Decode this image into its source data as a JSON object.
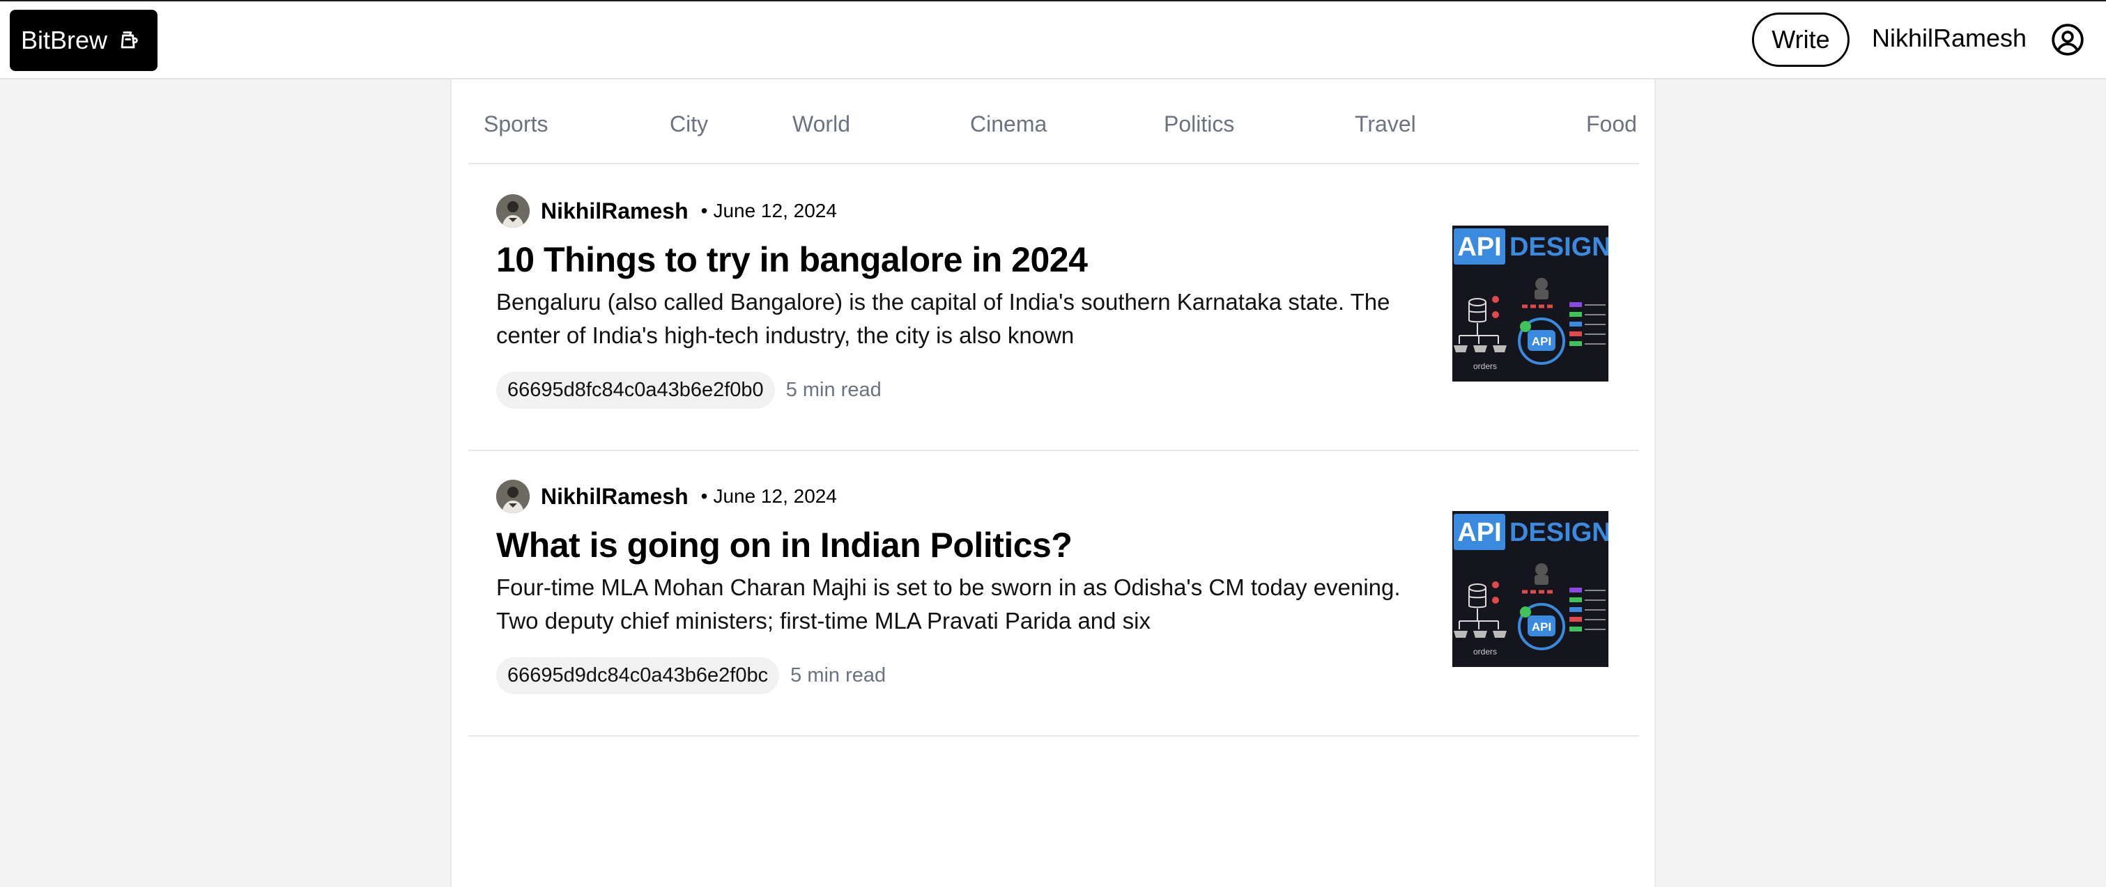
{
  "header": {
    "logo_text": "BitBrew",
    "logo_icon": "coffee-pot-icon",
    "write_label": "Write",
    "username": "NikhilRamesh",
    "profile_icon": "user-circle-icon"
  },
  "categories": [
    "Sports",
    "City",
    "World",
    "Cinema",
    "Politics",
    "Travel",
    "Food"
  ],
  "articles": [
    {
      "author": "NikhilRamesh",
      "separator": "•",
      "date": "June 12, 2024",
      "title": "10 Things to try in bangalore in 2024",
      "excerpt": "Bengaluru (also called Bangalore) is the capital of India's southern Karnataka state. The center of India's high-tech industry, the city is also known",
      "tag": "66695d8fc84c0a43b6e2f0b0",
      "read_time": "5 min read"
    },
    {
      "author": "NikhilRamesh",
      "separator": "•",
      "date": "June 12, 2024",
      "title": "What is going on in Indian Politics?",
      "excerpt": "Four-time MLA Mohan Charan Majhi is set to be sworn in as Odisha's CM today evening. Two deputy chief ministers; first-time MLA Pravati Parida and six",
      "tag": "66695d9dc84c0a43b6e2f0bc",
      "read_time": "5 min read"
    }
  ],
  "thumbnail": {
    "word1": "API",
    "word2": "DESIGN",
    "center_label": "API",
    "footer_label": "orders"
  },
  "colors": {
    "accent_blue": "#3a8be0",
    "thumb_bg": "#15161d"
  }
}
